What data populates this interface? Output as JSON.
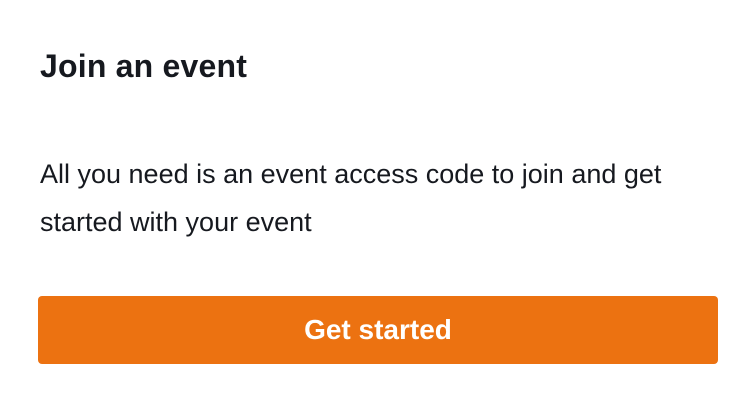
{
  "card": {
    "title": "Join an event",
    "description": "All you need is an event access code to join and get started with your event",
    "button_label": "Get started"
  },
  "colors": {
    "button_background": "#ec7211",
    "button_text": "#ffffff",
    "text": "#16191f",
    "background": "#ffffff"
  }
}
